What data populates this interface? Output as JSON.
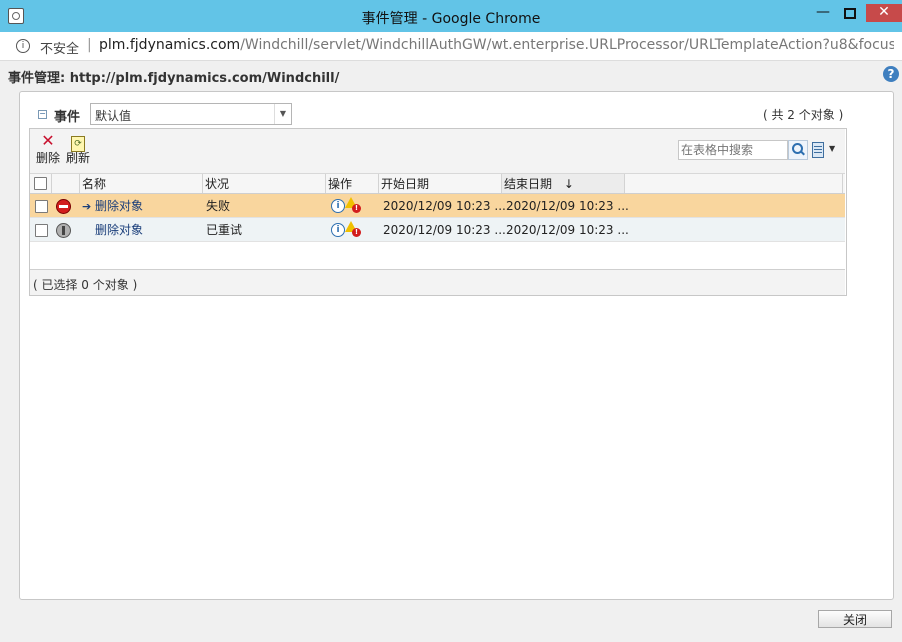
{
  "window": {
    "title": "事件管理 - Google Chrome",
    "min": "—",
    "close": "✕"
  },
  "address": {
    "security": "不安全",
    "separator": "|",
    "host": "plm.fjdynamics.com",
    "path": "/Windchill/servlet/WindchillAuthGW/wt.enterprise.URLProcessor/URLTemplateAction?u8&focus..."
  },
  "page": {
    "header": "事件管理: http://plm.fjdynamics.com/Windchill/",
    "help": "?"
  },
  "panel": {
    "collapse": "−",
    "label": "事件",
    "view_value": "默认值",
    "count": "( 共 2 个对象 )"
  },
  "toolbar": {
    "delete_label": "删除",
    "refresh_label": "刷新",
    "search_placeholder": "在表格中搜索"
  },
  "table": {
    "columns": [
      "名称",
      "状况",
      "操作",
      "开始日期",
      "结束日期"
    ],
    "sort_indicator": "↓",
    "rows": [
      {
        "arrow": "➔",
        "name": "删除对象",
        "status": "失败",
        "status_icon": "failed-icon",
        "start": "2020/12/09 10:23 ...",
        "end": "2020/12/09 10:23 ..."
      },
      {
        "arrow": "",
        "name": "删除对象",
        "status": "已重试",
        "status_icon": "retried-icon",
        "start": "2020/12/09 10:23 ...",
        "end": "2020/12/09 10:23 ..."
      }
    ],
    "selection_status": "( 已选择 0 个对象 )"
  },
  "close_button": "关闭",
  "colors": {
    "titlebar": "#62c4e7",
    "failed_row": "#f9d69e",
    "link": "#1a3e7a"
  }
}
